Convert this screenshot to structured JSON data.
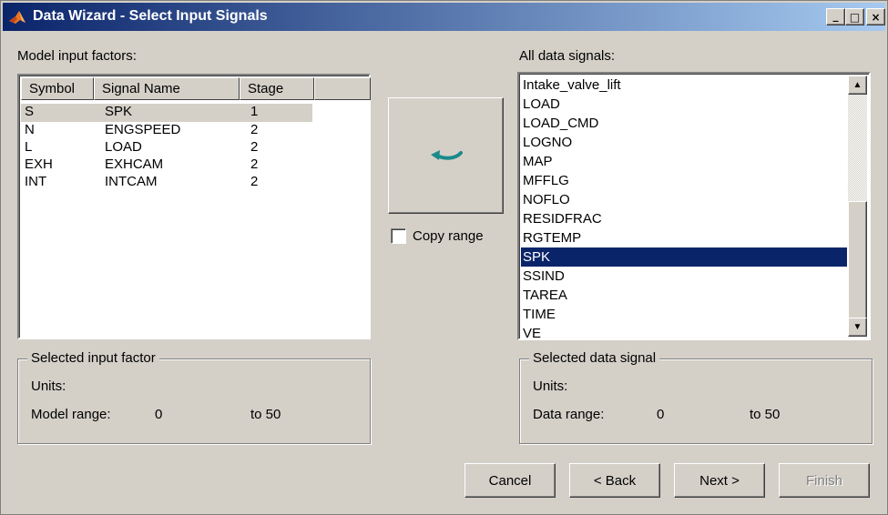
{
  "window": {
    "title": "Data Wizard - Select Input Signals",
    "controls": {
      "minimize": "_",
      "maximize": "□",
      "close": "×"
    }
  },
  "left": {
    "label": "Model input factors:",
    "columns": [
      "Symbol",
      "Signal Name",
      "Stage"
    ],
    "rows": [
      {
        "symbol": "S",
        "signal": "SPK",
        "stage": "1"
      },
      {
        "symbol": "N",
        "signal": "ENGSPEED",
        "stage": "2"
      },
      {
        "symbol": "L",
        "signal": "LOAD",
        "stage": "2"
      },
      {
        "symbol": "EXH",
        "signal": "EXHCAM",
        "stage": "2"
      },
      {
        "symbol": "INT",
        "signal": "INTCAM",
        "stage": "2"
      }
    ],
    "group": {
      "title": "Selected input factor",
      "units_label": "Units:",
      "range_label": "Model range:",
      "range_from": "0",
      "range_to": "to  50"
    }
  },
  "middle": {
    "map_button_icon": "curved-arrow-left-icon",
    "copy_range_label": "Copy range",
    "copy_range_checked": false
  },
  "right": {
    "label": "All data signals:",
    "items": [
      "Intake_valve_lift",
      "LOAD",
      "LOAD_CMD",
      "LOGNO",
      "MAP",
      "MFFLG",
      "NOFLO",
      "RESIDFRAC",
      "RGTEMP",
      "SPK",
      "SSIND",
      "TAREA",
      "TIME",
      "VE"
    ],
    "selected": "SPK",
    "group": {
      "title": "Selected data signal",
      "units_label": "Units:",
      "range_label": "Data range:",
      "range_from": "0",
      "range_to": "to  50"
    }
  },
  "buttons": {
    "cancel": "Cancel",
    "back": "< Back",
    "next": "Next >",
    "finish": "Finish"
  },
  "colors": {
    "dialog_bg": "#d4d0c8",
    "title_gradient_start": "#0a246a",
    "title_gradient_end": "#a6caf0",
    "selection": "#0a246a",
    "arrow": "#1a8a8a"
  }
}
